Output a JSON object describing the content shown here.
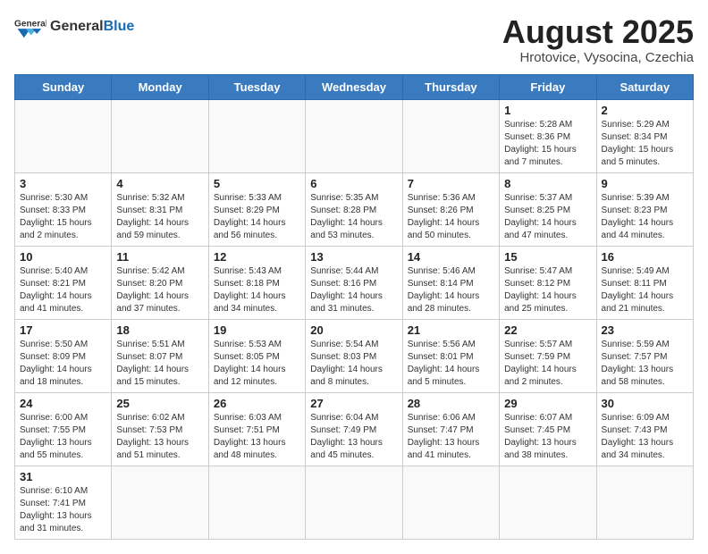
{
  "header": {
    "logo_general": "General",
    "logo_blue": "Blue",
    "month_title": "August 2025",
    "subtitle": "Hrotovice, Vysocina, Czechia"
  },
  "days_of_week": [
    "Sunday",
    "Monday",
    "Tuesday",
    "Wednesday",
    "Thursday",
    "Friday",
    "Saturday"
  ],
  "weeks": [
    [
      {
        "day": "",
        "info": ""
      },
      {
        "day": "",
        "info": ""
      },
      {
        "day": "",
        "info": ""
      },
      {
        "day": "",
        "info": ""
      },
      {
        "day": "",
        "info": ""
      },
      {
        "day": "1",
        "info": "Sunrise: 5:28 AM\nSunset: 8:36 PM\nDaylight: 15 hours\nand 7 minutes."
      },
      {
        "day": "2",
        "info": "Sunrise: 5:29 AM\nSunset: 8:34 PM\nDaylight: 15 hours\nand 5 minutes."
      }
    ],
    [
      {
        "day": "3",
        "info": "Sunrise: 5:30 AM\nSunset: 8:33 PM\nDaylight: 15 hours\nand 2 minutes."
      },
      {
        "day": "4",
        "info": "Sunrise: 5:32 AM\nSunset: 8:31 PM\nDaylight: 14 hours\nand 59 minutes."
      },
      {
        "day": "5",
        "info": "Sunrise: 5:33 AM\nSunset: 8:29 PM\nDaylight: 14 hours\nand 56 minutes."
      },
      {
        "day": "6",
        "info": "Sunrise: 5:35 AM\nSunset: 8:28 PM\nDaylight: 14 hours\nand 53 minutes."
      },
      {
        "day": "7",
        "info": "Sunrise: 5:36 AM\nSunset: 8:26 PM\nDaylight: 14 hours\nand 50 minutes."
      },
      {
        "day": "8",
        "info": "Sunrise: 5:37 AM\nSunset: 8:25 PM\nDaylight: 14 hours\nand 47 minutes."
      },
      {
        "day": "9",
        "info": "Sunrise: 5:39 AM\nSunset: 8:23 PM\nDaylight: 14 hours\nand 44 minutes."
      }
    ],
    [
      {
        "day": "10",
        "info": "Sunrise: 5:40 AM\nSunset: 8:21 PM\nDaylight: 14 hours\nand 41 minutes."
      },
      {
        "day": "11",
        "info": "Sunrise: 5:42 AM\nSunset: 8:20 PM\nDaylight: 14 hours\nand 37 minutes."
      },
      {
        "day": "12",
        "info": "Sunrise: 5:43 AM\nSunset: 8:18 PM\nDaylight: 14 hours\nand 34 minutes."
      },
      {
        "day": "13",
        "info": "Sunrise: 5:44 AM\nSunset: 8:16 PM\nDaylight: 14 hours\nand 31 minutes."
      },
      {
        "day": "14",
        "info": "Sunrise: 5:46 AM\nSunset: 8:14 PM\nDaylight: 14 hours\nand 28 minutes."
      },
      {
        "day": "15",
        "info": "Sunrise: 5:47 AM\nSunset: 8:12 PM\nDaylight: 14 hours\nand 25 minutes."
      },
      {
        "day": "16",
        "info": "Sunrise: 5:49 AM\nSunset: 8:11 PM\nDaylight: 14 hours\nand 21 minutes."
      }
    ],
    [
      {
        "day": "17",
        "info": "Sunrise: 5:50 AM\nSunset: 8:09 PM\nDaylight: 14 hours\nand 18 minutes."
      },
      {
        "day": "18",
        "info": "Sunrise: 5:51 AM\nSunset: 8:07 PM\nDaylight: 14 hours\nand 15 minutes."
      },
      {
        "day": "19",
        "info": "Sunrise: 5:53 AM\nSunset: 8:05 PM\nDaylight: 14 hours\nand 12 minutes."
      },
      {
        "day": "20",
        "info": "Sunrise: 5:54 AM\nSunset: 8:03 PM\nDaylight: 14 hours\nand 8 minutes."
      },
      {
        "day": "21",
        "info": "Sunrise: 5:56 AM\nSunset: 8:01 PM\nDaylight: 14 hours\nand 5 minutes."
      },
      {
        "day": "22",
        "info": "Sunrise: 5:57 AM\nSunset: 7:59 PM\nDaylight: 14 hours\nand 2 minutes."
      },
      {
        "day": "23",
        "info": "Sunrise: 5:59 AM\nSunset: 7:57 PM\nDaylight: 13 hours\nand 58 minutes."
      }
    ],
    [
      {
        "day": "24",
        "info": "Sunrise: 6:00 AM\nSunset: 7:55 PM\nDaylight: 13 hours\nand 55 minutes."
      },
      {
        "day": "25",
        "info": "Sunrise: 6:02 AM\nSunset: 7:53 PM\nDaylight: 13 hours\nand 51 minutes."
      },
      {
        "day": "26",
        "info": "Sunrise: 6:03 AM\nSunset: 7:51 PM\nDaylight: 13 hours\nand 48 minutes."
      },
      {
        "day": "27",
        "info": "Sunrise: 6:04 AM\nSunset: 7:49 PM\nDaylight: 13 hours\nand 45 minutes."
      },
      {
        "day": "28",
        "info": "Sunrise: 6:06 AM\nSunset: 7:47 PM\nDaylight: 13 hours\nand 41 minutes."
      },
      {
        "day": "29",
        "info": "Sunrise: 6:07 AM\nSunset: 7:45 PM\nDaylight: 13 hours\nand 38 minutes."
      },
      {
        "day": "30",
        "info": "Sunrise: 6:09 AM\nSunset: 7:43 PM\nDaylight: 13 hours\nand 34 minutes."
      }
    ],
    [
      {
        "day": "31",
        "info": "Sunrise: 6:10 AM\nSunset: 7:41 PM\nDaylight: 13 hours\nand 31 minutes."
      },
      {
        "day": "",
        "info": ""
      },
      {
        "day": "",
        "info": ""
      },
      {
        "day": "",
        "info": ""
      },
      {
        "day": "",
        "info": ""
      },
      {
        "day": "",
        "info": ""
      },
      {
        "day": "",
        "info": ""
      }
    ]
  ]
}
